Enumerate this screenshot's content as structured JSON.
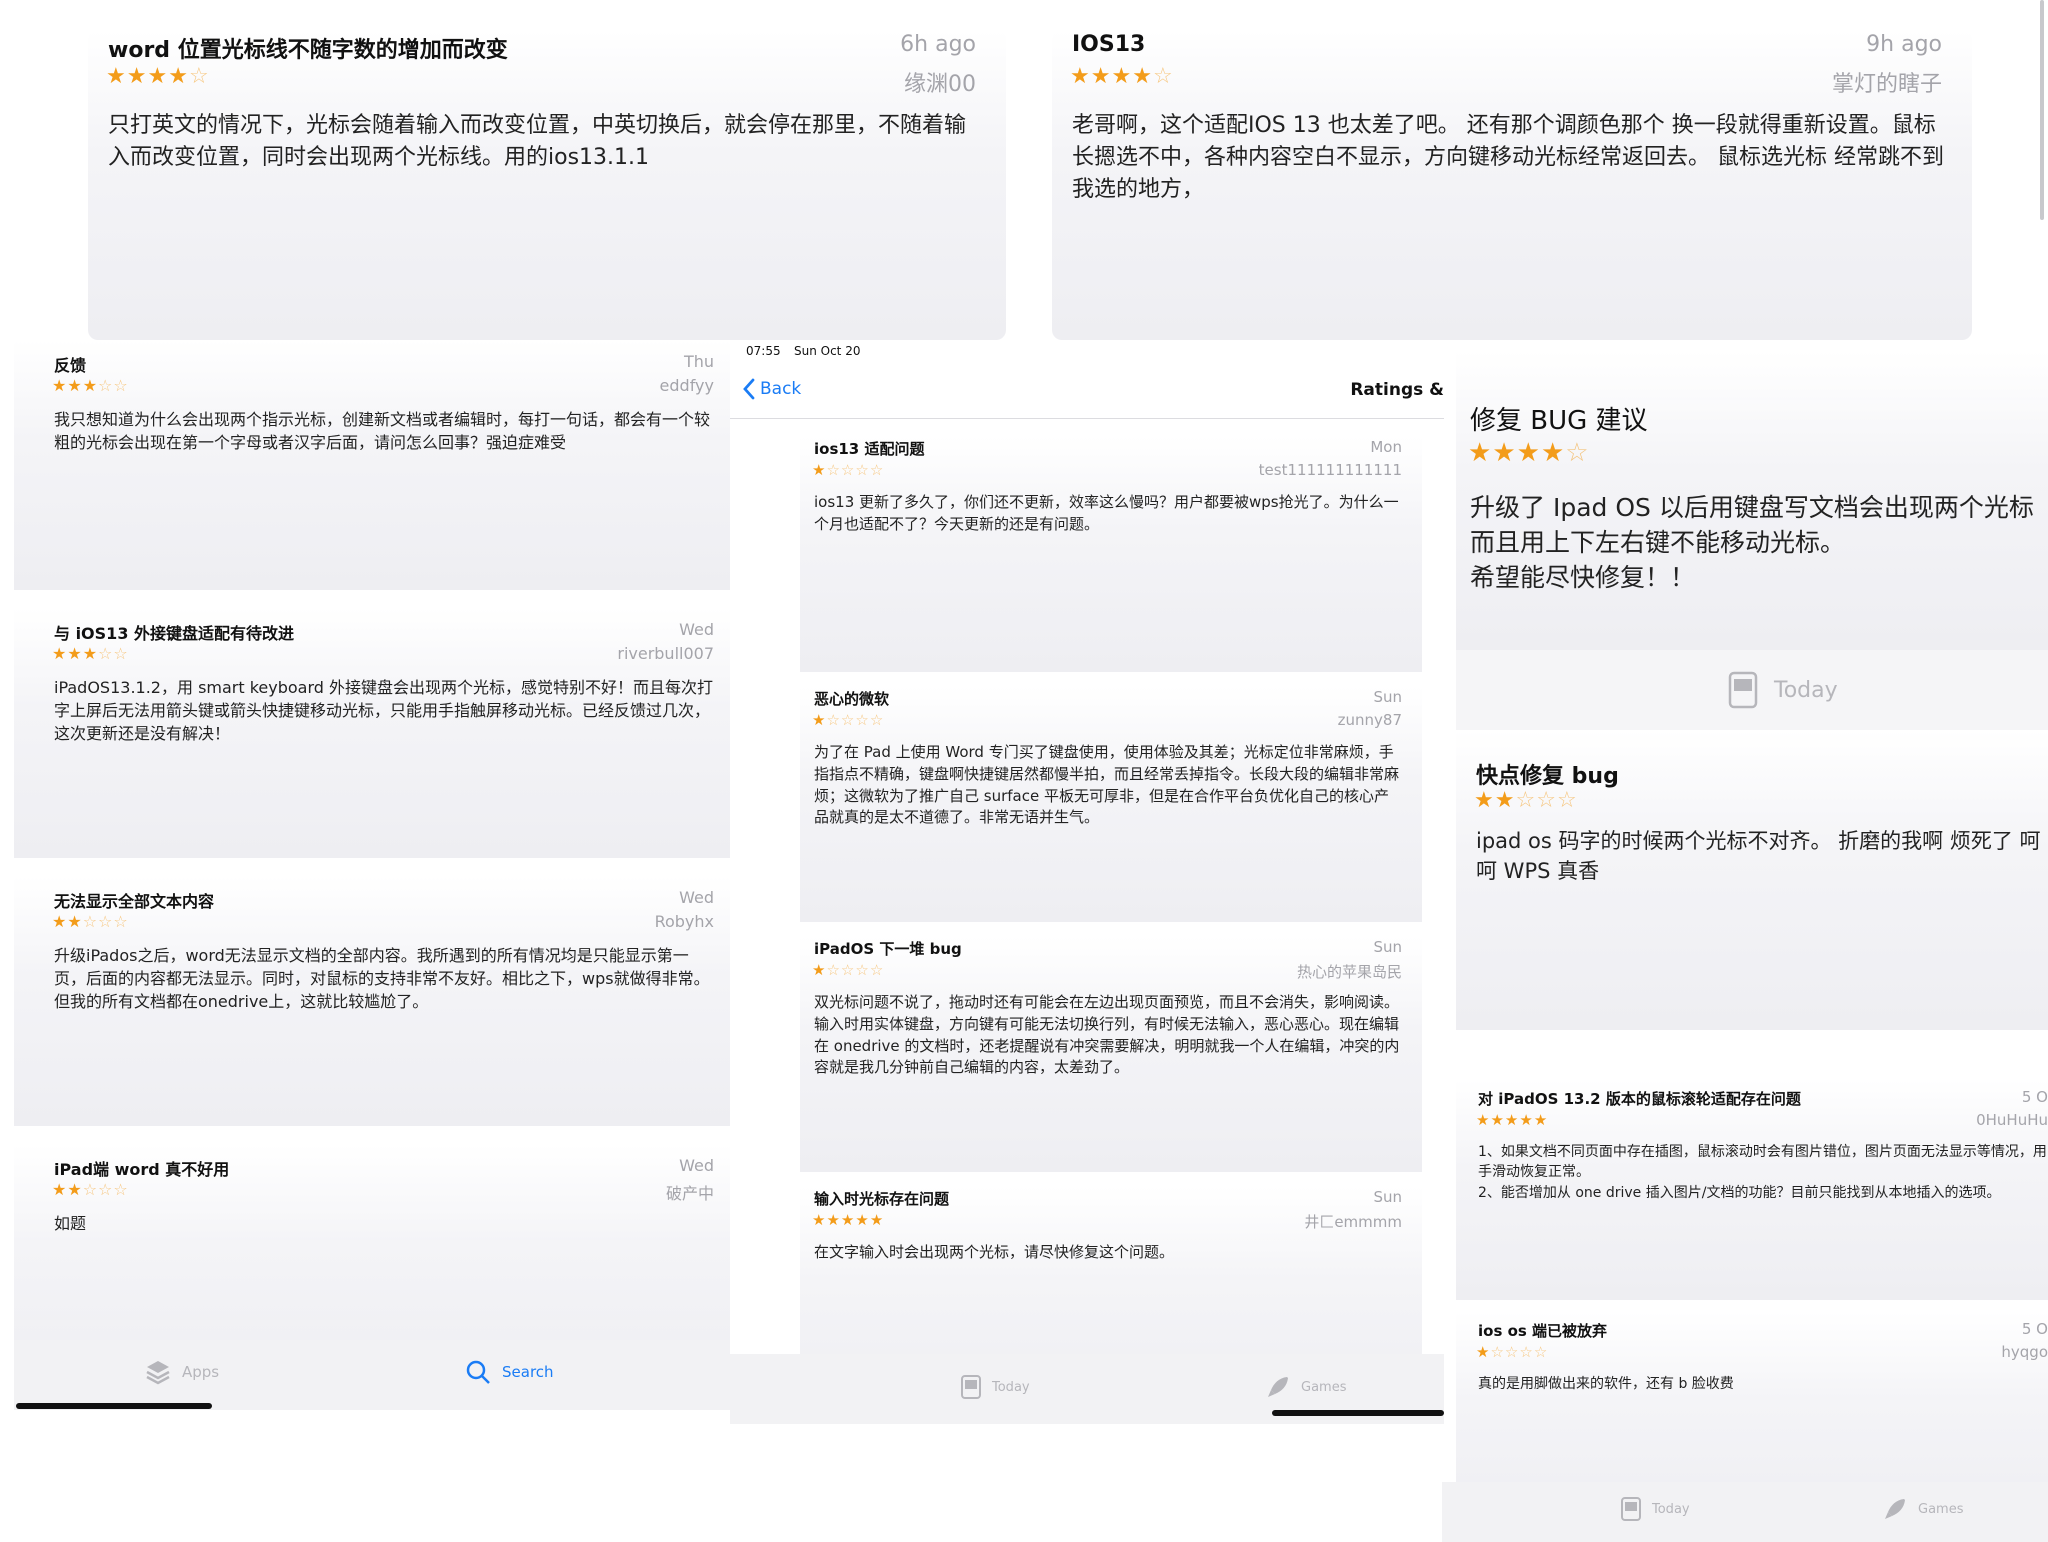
{
  "top_left": {
    "title": "word 位置光标线不随字数的增加而改变",
    "when": "6h ago",
    "author": "缘渊00",
    "stars": 4,
    "body": "只打英文的情况下，光标会随着输入而改变位置，中英切换后，就会停在那里，不随着输入而改变位置，同时会出现两个光标线。用的ios13.1.1"
  },
  "top_right": {
    "title": "IOS13",
    "when": "9h ago",
    "author": "掌灯的瞎子",
    "stars": 4,
    "body": "老哥啊，这个适配IOS 13 也太差了吧。 还有那个调颜色那个 换一段就得重新设置。鼠标长摁选不中，各种内容空白不显示，方向键移动光标经常返回去。 鼠标选光标 经常跳不到我选的地方，"
  },
  "left_panel": {
    "reviews": [
      {
        "title": "反馈",
        "when": "Thu",
        "author": "eddfyy",
        "stars": 3,
        "body": "我只想知道为什么会出现两个指示光标，创建新文档或者编辑时，每打一句话，都会有一个较粗的光标会出现在第一个字母或者汉字后面，请问怎么回事？强迫症难受"
      },
      {
        "title": "与 iOS13 外接键盘适配有待改进",
        "when": "Wed",
        "author": "riverbull007",
        "stars": 3,
        "body": "iPadOS13.1.2，用 smart keyboard 外接键盘会出现两个光标，感觉特别不好！而且每次打字上屏后无法用箭头键或箭头快捷键移动光标，只能用手指触屏移动光标。已经反馈过几次，这次更新还是没有解决！"
      },
      {
        "title": "无法显示全部文本内容",
        "when": "Wed",
        "author": "Robyhx",
        "stars": 2,
        "body": "升级iPados之后，word无法显示文档的全部内容。我所遇到的所有情况均是只能显示第一页，后面的内容都无法显示。同时，对鼠标的支持非常不友好。相比之下，wps就做得非常。但我的所有文档都在onedrive上，这就比较尴尬了。"
      },
      {
        "title": "iPad端 word 真不好用",
        "when": "Wed",
        "author": "破产中",
        "stars": 2,
        "body": "如题"
      }
    ],
    "tabs": [
      {
        "icon": "apps-stack-icon",
        "label": "Apps"
      },
      {
        "icon": "search-icon",
        "label": "Search"
      }
    ]
  },
  "middle_panel": {
    "status_time": "07:55",
    "status_date": "Sun Oct 20",
    "back_label": "Back",
    "nav_title": "Ratings &",
    "reviews": [
      {
        "title": "ios13 适配问题",
        "when": "Mon",
        "author": "test111111111111",
        "stars": 1,
        "body": "ios13 更新了多久了，你们还不更新，效率这么慢吗？用户都要被wps抢光了。为什么一个月也适配不了？今天更新的还是有问题。"
      },
      {
        "title": "恶心的微软",
        "when": "Sun",
        "author": "zunny87",
        "stars": 1,
        "body": "为了在 Pad 上使用 Word 专门买了键盘使用，使用体验及其差；光标定位非常麻烦，手指指点不精确，键盘啊快捷键居然都慢半拍，而且经常丢掉指令。长段大段的编辑非常麻烦；这微软为了推广自己 surface 平板无可厚非，但是在合作平台负优化自己的核心产品就真的是太不道德了。非常无语并生气。"
      },
      {
        "title": "iPadOS 下一堆 bug",
        "when": "Sun",
        "author": "热心的苹果岛民",
        "stars": 1,
        "body": "双光标问题不说了，拖动时还有可能会在左边出现页面预览，而且不会消失，影响阅读。输入时用实体键盘，方向键有可能无法切换行列，有时候无法输入，恶心恶心。现在编辑在 onedrive 的文档时，还老提醒说有冲突需要解决，明明就我一个人在编辑，冲突的内容就是我几分钟前自己编辑的内容，太差劲了。"
      },
      {
        "title": "输入时光标存在问题",
        "when": "Sun",
        "author": "井匚emmmm",
        "stars": 5,
        "body": "在文字输入时会出现两个光标，请尽快修复这个问题。"
      }
    ],
    "tabs": [
      {
        "icon": "today-icon",
        "label": "Today"
      },
      {
        "icon": "games-rocket-icon",
        "label": "Games"
      }
    ]
  },
  "right_panel": {
    "big_review": {
      "title": "修复 BUG 建议",
      "stars": 4,
      "body": "升级了 Ipad OS 以后用键盘写文档会出现两个光标\n而且用上下左右键不能移动光标。\n希望能尽快修复！！"
    },
    "today_label": "Today",
    "mid_review": {
      "title": "快点修复 bug",
      "stars": 2,
      "body": "ipad os 码字的时候两个光标不对齐。 折磨的我啊 烦死了 呵呵 WPS 真香"
    },
    "reviews": [
      {
        "title": "对 iPadOS 13.2 版本的鼠标滚轮适配存在问题",
        "when": "5 O",
        "author": "0HuHuHu",
        "stars": 5,
        "body": "1、如果文档不同页面中存在插图，鼠标滚动时会有图片错位，图片页面无法显示等情况，用手滑动恢复正常。\n2、能否增加从 one drive 插入图片/文档的功能？目前只能找到从本地插入的选项。"
      },
      {
        "title": "ios os 端已被放弃",
        "when": "5 O",
        "author": "hyqgo",
        "stars": 1,
        "body": "真的是用脚做出来的软件，还有 b 脸收费"
      }
    ],
    "tabs": [
      {
        "icon": "today-icon",
        "label": "Today"
      },
      {
        "icon": "games-rocket-icon",
        "label": "Games"
      }
    ]
  },
  "colors": {
    "star": "#f39c1a",
    "link": "#1a7cf5",
    "muted": "#a4a4aa"
  }
}
